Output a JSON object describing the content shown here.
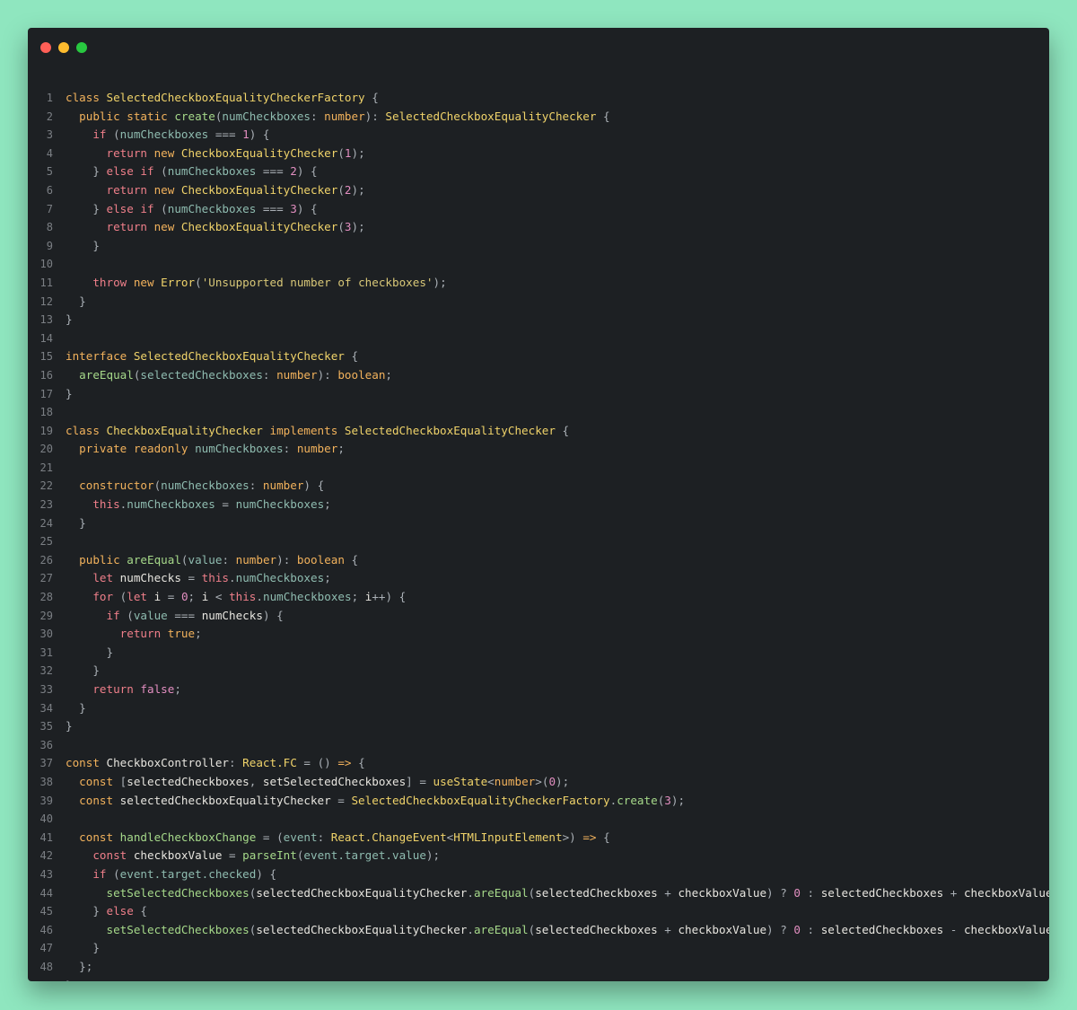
{
  "window": {
    "controls": [
      "close",
      "minimize",
      "maximize"
    ]
  },
  "colors": {
    "background": "#8fe6bf",
    "editor": "#1d2023",
    "keyword": "#f2b25c",
    "control": "#ef7f8a",
    "class": "#f0d36a",
    "function": "#a6d98a",
    "variable": "#8fbcb0",
    "number": "#e28ec0",
    "string": "#d9c878",
    "punctuation": "#aab0b6",
    "plain": "#e7e5df"
  },
  "code_lines": [
    [
      [
        "kw",
        "class "
      ],
      [
        "cls",
        "SelectedCheckboxEqualityCheckerFactory"
      ],
      [
        "pun",
        " {"
      ]
    ],
    [
      [
        "kw",
        "  public static "
      ],
      [
        "fn",
        "create"
      ],
      [
        "pun",
        "("
      ],
      [
        "var",
        "numCheckboxes"
      ],
      [
        "pun",
        ": "
      ],
      [
        "kw",
        "number"
      ],
      [
        "pun",
        "): "
      ],
      [
        "cls",
        "SelectedCheckboxEqualityChecker"
      ],
      [
        "pun",
        " {"
      ]
    ],
    [
      [
        "ctl",
        "    if "
      ],
      [
        "pun",
        "("
      ],
      [
        "var",
        "numCheckboxes"
      ],
      [
        "pun",
        " === "
      ],
      [
        "num",
        "1"
      ],
      [
        "pun",
        ") {"
      ]
    ],
    [
      [
        "ctl",
        "      return "
      ],
      [
        "kw",
        "new "
      ],
      [
        "cls",
        "CheckboxEqualityChecker"
      ],
      [
        "pun",
        "("
      ],
      [
        "num",
        "1"
      ],
      [
        "pun",
        ");"
      ]
    ],
    [
      [
        "pun",
        "    } "
      ],
      [
        "ctl",
        "else if "
      ],
      [
        "pun",
        "("
      ],
      [
        "var",
        "numCheckboxes"
      ],
      [
        "pun",
        " === "
      ],
      [
        "num",
        "2"
      ],
      [
        "pun",
        ") {"
      ]
    ],
    [
      [
        "ctl",
        "      return "
      ],
      [
        "kw",
        "new "
      ],
      [
        "cls",
        "CheckboxEqualityChecker"
      ],
      [
        "pun",
        "("
      ],
      [
        "num",
        "2"
      ],
      [
        "pun",
        ");"
      ]
    ],
    [
      [
        "pun",
        "    } "
      ],
      [
        "ctl",
        "else if "
      ],
      [
        "pun",
        "("
      ],
      [
        "var",
        "numCheckboxes"
      ],
      [
        "pun",
        " === "
      ],
      [
        "num",
        "3"
      ],
      [
        "pun",
        ") {"
      ]
    ],
    [
      [
        "ctl",
        "      return "
      ],
      [
        "kw",
        "new "
      ],
      [
        "cls",
        "CheckboxEqualityChecker"
      ],
      [
        "pun",
        "("
      ],
      [
        "num",
        "3"
      ],
      [
        "pun",
        ");"
      ]
    ],
    [
      [
        "pun",
        "    }"
      ]
    ],
    [],
    [
      [
        "ctl",
        "    throw "
      ],
      [
        "kw",
        "new "
      ],
      [
        "cls",
        "Error"
      ],
      [
        "pun",
        "("
      ],
      [
        "str",
        "'Unsupported number of checkboxes'"
      ],
      [
        "pun",
        ");"
      ]
    ],
    [
      [
        "pun",
        "  }"
      ]
    ],
    [
      [
        "pun",
        "}"
      ]
    ],
    [],
    [
      [
        "kw",
        "interface "
      ],
      [
        "cls",
        "SelectedCheckboxEqualityChecker"
      ],
      [
        "pun",
        " {"
      ]
    ],
    [
      [
        "fn",
        "  areEqual"
      ],
      [
        "pun",
        "("
      ],
      [
        "var",
        "selectedCheckboxes"
      ],
      [
        "pun",
        ": "
      ],
      [
        "kw",
        "number"
      ],
      [
        "pun",
        "): "
      ],
      [
        "kw",
        "boolean"
      ],
      [
        "pun",
        ";"
      ]
    ],
    [
      [
        "pun",
        "}"
      ]
    ],
    [],
    [
      [
        "kw",
        "class "
      ],
      [
        "cls",
        "CheckboxEqualityChecker "
      ],
      [
        "kw",
        "implements "
      ],
      [
        "cls",
        "SelectedCheckboxEqualityChecker"
      ],
      [
        "pun",
        " {"
      ]
    ],
    [
      [
        "kw",
        "  private readonly "
      ],
      [
        "var",
        "numCheckboxes"
      ],
      [
        "pun",
        ": "
      ],
      [
        "kw",
        "number"
      ],
      [
        "pun",
        ";"
      ]
    ],
    [],
    [
      [
        "kw",
        "  constructor"
      ],
      [
        "pun",
        "("
      ],
      [
        "var",
        "numCheckboxes"
      ],
      [
        "pun",
        ": "
      ],
      [
        "kw",
        "number"
      ],
      [
        "pun",
        ") {"
      ]
    ],
    [
      [
        "ctl",
        "    this"
      ],
      [
        "pun",
        "."
      ],
      [
        "var",
        "numCheckboxes"
      ],
      [
        "pun",
        " = "
      ],
      [
        "var",
        "numCheckboxes"
      ],
      [
        "pun",
        ";"
      ]
    ],
    [
      [
        "pun",
        "  }"
      ]
    ],
    [],
    [
      [
        "kw",
        "  public "
      ],
      [
        "fn",
        "areEqual"
      ],
      [
        "pun",
        "("
      ],
      [
        "var",
        "value"
      ],
      [
        "pun",
        ": "
      ],
      [
        "kw",
        "number"
      ],
      [
        "pun",
        "): "
      ],
      [
        "kw",
        "boolean"
      ],
      [
        "pun",
        " {"
      ]
    ],
    [
      [
        "ctl",
        "    let "
      ],
      [
        "plain",
        "numChecks"
      ],
      [
        "pun",
        " = "
      ],
      [
        "ctl",
        "this"
      ],
      [
        "pun",
        "."
      ],
      [
        "var",
        "numCheckboxes"
      ],
      [
        "pun",
        ";"
      ]
    ],
    [
      [
        "ctl",
        "    for "
      ],
      [
        "pun",
        "("
      ],
      [
        "ctl",
        "let "
      ],
      [
        "plain",
        "i"
      ],
      [
        "pun",
        " = "
      ],
      [
        "num",
        "0"
      ],
      [
        "pun",
        "; "
      ],
      [
        "plain",
        "i"
      ],
      [
        "pun",
        " < "
      ],
      [
        "ctl",
        "this"
      ],
      [
        "pun",
        "."
      ],
      [
        "var",
        "numCheckboxes"
      ],
      [
        "pun",
        "; "
      ],
      [
        "plain",
        "i"
      ],
      [
        "pun",
        "++) {"
      ]
    ],
    [
      [
        "ctl",
        "      if "
      ],
      [
        "pun",
        "("
      ],
      [
        "var",
        "value"
      ],
      [
        "pun",
        " === "
      ],
      [
        "plain",
        "numChecks"
      ],
      [
        "pun",
        ") {"
      ]
    ],
    [
      [
        "ctl",
        "        return "
      ],
      [
        "kw",
        "true"
      ],
      [
        "pun",
        ";"
      ]
    ],
    [
      [
        "pun",
        "      }"
      ]
    ],
    [
      [
        "pun",
        "    }"
      ]
    ],
    [
      [
        "ctl",
        "    return "
      ],
      [
        "num",
        "false"
      ],
      [
        "pun",
        ";"
      ]
    ],
    [
      [
        "pun",
        "  }"
      ]
    ],
    [
      [
        "pun",
        "}"
      ]
    ],
    [],
    [
      [
        "kw",
        "const "
      ],
      [
        "plain",
        "CheckboxController"
      ],
      [
        "pun",
        ": "
      ],
      [
        "cls",
        "React.FC"
      ],
      [
        "pun",
        " = () "
      ],
      [
        "kw",
        "=>"
      ],
      [
        "pun",
        " {"
      ]
    ],
    [
      [
        "kw",
        "  const "
      ],
      [
        "pun",
        "["
      ],
      [
        "plain",
        "selectedCheckboxes"
      ],
      [
        "pun",
        ", "
      ],
      [
        "plain",
        "setSelectedCheckboxes"
      ],
      [
        "pun",
        "] = "
      ],
      [
        "cls",
        "useState"
      ],
      [
        "pun",
        "<"
      ],
      [
        "kw",
        "number"
      ],
      [
        "pun",
        ">("
      ],
      [
        "num",
        "0"
      ],
      [
        "pun",
        ");"
      ]
    ],
    [
      [
        "kw",
        "  const "
      ],
      [
        "plain",
        "selectedCheckboxEqualityChecker"
      ],
      [
        "pun",
        " = "
      ],
      [
        "cls",
        "SelectedCheckboxEqualityCheckerFactory"
      ],
      [
        "pun",
        "."
      ],
      [
        "fn",
        "create"
      ],
      [
        "pun",
        "("
      ],
      [
        "num",
        "3"
      ],
      [
        "pun",
        ");"
      ]
    ],
    [],
    [
      [
        "kw",
        "  const "
      ],
      [
        "fn",
        "handleCheckboxChange"
      ],
      [
        "pun",
        " = ("
      ],
      [
        "var",
        "event"
      ],
      [
        "pun",
        ": "
      ],
      [
        "cls",
        "React.ChangeEvent"
      ],
      [
        "pun",
        "<"
      ],
      [
        "cls",
        "HTMLInputElement"
      ],
      [
        "pun",
        ">) "
      ],
      [
        "kw",
        "=>"
      ],
      [
        "pun",
        " {"
      ]
    ],
    [
      [
        "ctl",
        "    const "
      ],
      [
        "plain",
        "checkboxValue"
      ],
      [
        "pun",
        " = "
      ],
      [
        "fn",
        "parseInt"
      ],
      [
        "pun",
        "("
      ],
      [
        "var",
        "event.target.value"
      ],
      [
        "pun",
        ");"
      ]
    ],
    [
      [
        "ctl",
        "    if "
      ],
      [
        "pun",
        "("
      ],
      [
        "var",
        "event.target.checked"
      ],
      [
        "pun",
        ") {"
      ]
    ],
    [
      [
        "fn",
        "      setSelectedCheckboxes"
      ],
      [
        "pun",
        "("
      ],
      [
        "plain",
        "selectedCheckboxEqualityChecker"
      ],
      [
        "pun",
        "."
      ],
      [
        "fn",
        "areEqual"
      ],
      [
        "pun",
        "("
      ],
      [
        "plain",
        "selectedCheckboxes"
      ],
      [
        "pun",
        " + "
      ],
      [
        "plain",
        "checkboxValue"
      ],
      [
        "pun",
        ") ? "
      ],
      [
        "num",
        "0"
      ],
      [
        "pun",
        " : "
      ],
      [
        "plain",
        "selectedCheckboxes"
      ],
      [
        "pun",
        " + "
      ],
      [
        "plain",
        "checkboxValue"
      ],
      [
        "pun",
        ");"
      ]
    ],
    [
      [
        "pun",
        "    } "
      ],
      [
        "ctl",
        "else"
      ],
      [
        "pun",
        " {"
      ]
    ],
    [
      [
        "fn",
        "      setSelectedCheckboxes"
      ],
      [
        "pun",
        "("
      ],
      [
        "plain",
        "selectedCheckboxEqualityChecker"
      ],
      [
        "pun",
        "."
      ],
      [
        "fn",
        "areEqual"
      ],
      [
        "pun",
        "("
      ],
      [
        "plain",
        "selectedCheckboxes"
      ],
      [
        "pun",
        " + "
      ],
      [
        "plain",
        "checkboxValue"
      ],
      [
        "pun",
        ") ? "
      ],
      [
        "num",
        "0"
      ],
      [
        "pun",
        " : "
      ],
      [
        "plain",
        "selectedCheckboxes"
      ],
      [
        "pun",
        " - "
      ],
      [
        "plain",
        "checkboxValue"
      ],
      [
        "pun",
        ");"
      ]
    ],
    [
      [
        "pun",
        "    }"
      ]
    ],
    [
      [
        "pun",
        "  };"
      ]
    ],
    [
      [
        "pun",
        "}"
      ]
    ]
  ]
}
